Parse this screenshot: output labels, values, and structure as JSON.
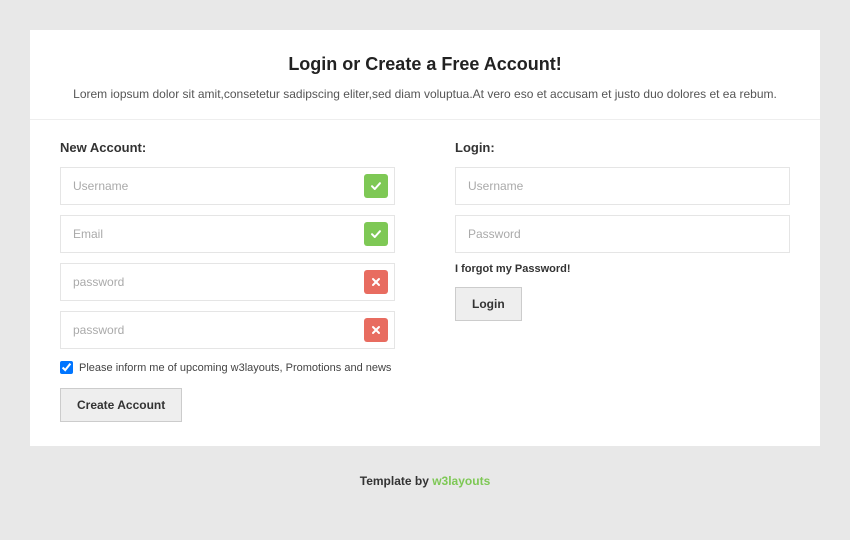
{
  "header": {
    "title": "Login or Create a Free Account!",
    "subtitle": "Lorem iopsum dolor sit amit,consetetur sadipscing eliter,sed diam voluptua.At vero eso et accusam et justo duo dolores et ea rebum."
  },
  "signup": {
    "title": "New Account:",
    "username_placeholder": "Username",
    "email_placeholder": "Email",
    "password1_placeholder": "password",
    "password2_placeholder": "password",
    "newsletter_label": "Please inform me of upcoming w3layouts, Promotions and news",
    "create_button": "Create Account"
  },
  "login": {
    "title": "Login:",
    "username_placeholder": "Username",
    "password_placeholder": "Password",
    "forgot": "I forgot my Password!",
    "login_button": "Login"
  },
  "footer": {
    "prefix": "Template by ",
    "link": "w3layouts"
  }
}
